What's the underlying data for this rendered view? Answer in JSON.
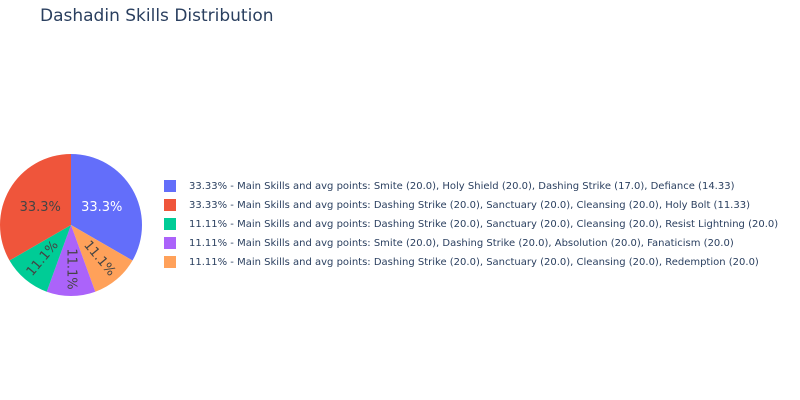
{
  "chart_data": {
    "type": "pie",
    "title": "Dashadin Skills Distribution",
    "direction": "clockwise",
    "start_angle": "top",
    "sort": "descending",
    "slices": [
      {
        "label": "33.33% - Main Skills and avg points: Smite (20.0), Holy Shield (20.0), Dashing Strike (17.0), Defiance (14.33)",
        "value": 33.33,
        "text": "33.3%",
        "color": "#636efa",
        "text_color": "#ffffff",
        "text_orientation": "horizontal"
      },
      {
        "label": "11.11% - Main Skills and avg points: Dashing Strike (20.0), Sanctuary (20.0), Cleansing (20.0), Redemption (20.0)",
        "value": 11.11,
        "text": "11.1%",
        "color": "#ffa15a",
        "text_color": "#444444",
        "text_orientation": "radial"
      },
      {
        "label": "11.11% - Main Skills and avg points: Smite (20.0), Dashing Strike (20.0), Absolution (20.0), Fanaticism (20.0)",
        "value": 11.11,
        "text": "11.1%",
        "color": "#ab63fa",
        "text_color": "#444444",
        "text_orientation": "radial"
      },
      {
        "label": "11.11% - Main Skills and avg points: Dashing Strike (20.0), Sanctuary (20.0), Cleansing (20.0), Resist Lightning (20.0)",
        "value": 11.11,
        "text": "11.1%",
        "color": "#00cc96",
        "text_color": "#444444",
        "text_orientation": "radial"
      },
      {
        "label": "33.33% - Main Skills and avg points: Dashing Strike (20.0), Sanctuary (20.0), Cleansing (20.0), Holy Bolt (11.33)",
        "value": 33.33,
        "text": "33.3%",
        "color": "#ef553b",
        "text_color": "#444444",
        "text_orientation": "horizontal"
      }
    ],
    "legend": {
      "position": "right",
      "order": [
        0,
        4,
        3,
        2,
        1
      ]
    }
  }
}
